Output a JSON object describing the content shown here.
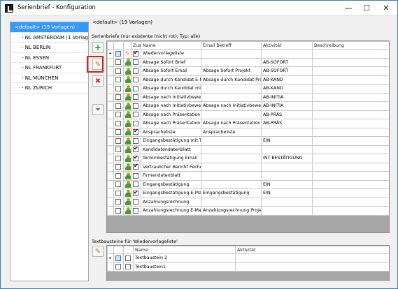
{
  "window": {
    "title": "Serienbrief - Konfiguration",
    "minimize": "—",
    "maximize": "☐",
    "close": "✕"
  },
  "sidebar": {
    "items": [
      {
        "label": "<default> (19 Vorlagen)",
        "selected": true
      },
      {
        "label": "- NL AMSTERDAM (1 Vorlagen)"
      },
      {
        "label": "- NL BERLIN"
      },
      {
        "label": "- NL ESSEN"
      },
      {
        "label": "- NL FRANKFURT"
      },
      {
        "label": "- NL MÜNCHEN"
      },
      {
        "label": "- NL ZÜRICH"
      }
    ]
  },
  "main": {
    "header": "<default> (19 Vorlagen)",
    "subheader": "Serienbriefe (nur existente (nicht rot); Typ: alle)",
    "toolbar_icons": [
      "add-icon",
      "edit-icon",
      "delete-icon",
      "filter-icon"
    ],
    "columns": [
      "Zus.",
      "Name",
      "Email Betreff",
      "Aktivität",
      "Beschreibung"
    ],
    "rows": [
      {
        "zus": true,
        "name": "Wiedervorlageliste",
        "betreff": "",
        "aktivitaet": "",
        "current": true,
        "icon": "pencil"
      },
      {
        "zus": false,
        "name": "Absage Sofort Brief",
        "betreff": "",
        "aktivitaet": "AB-SOFORT"
      },
      {
        "zus": false,
        "name": "Absage Sofort Email",
        "betreff": "Absage Sofort Projekt",
        "aktivitaet": "AB-SOFORT"
      },
      {
        "zus": false,
        "name": "Absage durch Kandidat E-M...",
        "betreff": "Absage durch Kandidat Pro...",
        "aktivitaet": "AB-KAND"
      },
      {
        "zus": false,
        "name": "Absage durch Kandidat mit ...",
        "betreff": "",
        "aktivitaet": "AB-KAND"
      },
      {
        "zus": false,
        "name": "Absage nach Initiativbewer...",
        "betreff": "",
        "aktivitaet": "AB-INITIA"
      },
      {
        "zus": false,
        "name": "Absage nach Initiativbewer...",
        "betreff": "Absage nach Initiativbewer...",
        "aktivitaet": "AB-INITIA"
      },
      {
        "zus": false,
        "name": "Absage nach Präsentation",
        "betreff": "",
        "aktivitaet": "AB-PRÄS"
      },
      {
        "zus": false,
        "name": "Absage nach Präsentation ...",
        "betreff": "Absage nach Präsentation ...",
        "aktivitaet": "AB-PRÄS"
      },
      {
        "zus": true,
        "name": "Anspracheliste",
        "betreff": "Anspracheliste",
        "aktivitaet": ""
      },
      {
        "zus": false,
        "name": "Eingangsbestätigung mit Te...",
        "betreff": "",
        "aktivitaet": "EIN"
      },
      {
        "zus": true,
        "name": "Kandidatendatenblatt",
        "betreff": "",
        "aktivitaet": ""
      },
      {
        "zus": true,
        "name": "Terminbestätigung Email",
        "betreff": "",
        "aktivitaet": "INT BESTÄTIGUNG"
      },
      {
        "zus": true,
        "name": "Vertraulicher Bericht Fecher",
        "betreff": "",
        "aktivitaet": ""
      },
      {
        "zus": false,
        "name": "Firmendatenblatt",
        "betreff": "",
        "aktivitaet": ""
      },
      {
        "zus": false,
        "name": "Eingangsbestätigung",
        "betreff": "",
        "aktivitaet": "EIN"
      },
      {
        "zus": true,
        "name": "Eingangsbestätigung E-Mail",
        "betreff": "Eingangsbestätigung",
        "aktivitaet": "EIN"
      },
      {
        "zus": false,
        "name": "Anzahlungsrechnung",
        "betreff": "",
        "aktivitaet": ""
      },
      {
        "zus": false,
        "name": "Anzahlungsrechnung E-Mail",
        "betreff": "Anzahlungsrechnung Projekt",
        "aktivitaet": ""
      }
    ]
  },
  "lower": {
    "label": "Textbausteine für 'Wiedervorlageliste'",
    "columns": [
      "Name",
      "Aktivität"
    ],
    "rows": [
      {
        "name": "Textbaustein 2",
        "current": true
      },
      {
        "name": "Textbaustein1"
      }
    ]
  },
  "colors": {
    "selection": "#3399ff",
    "annotation": "#d42020"
  }
}
